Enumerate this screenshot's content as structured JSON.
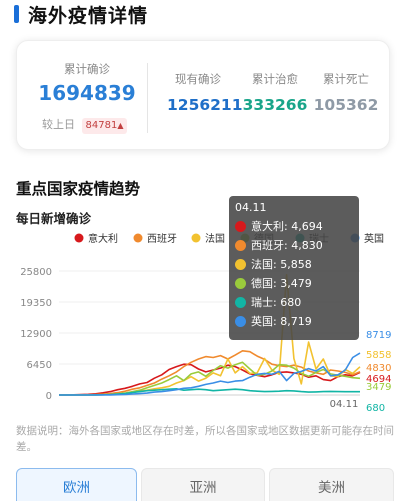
{
  "header": {
    "title": "海外疫情详情"
  },
  "summary": {
    "confirmed_label": "累计确诊",
    "confirmed_value": "1694839",
    "compare_label": "较上日",
    "compare_value": "84781",
    "compare_arrow": "▲",
    "stats": [
      {
        "label": "现有确诊",
        "value": "1256211",
        "color": "#1f6fc8"
      },
      {
        "label": "累计治愈",
        "value": "333266",
        "color": "#19a58a"
      },
      {
        "label": "累计死亡",
        "value": "105362",
        "color": "#8f9aa6"
      }
    ]
  },
  "trend": {
    "section_title": "重点国家疫情趋势",
    "chart_title": "每日新增确诊"
  },
  "chart_data": {
    "type": "line",
    "y_ticks": [
      "25800",
      "19350",
      "12900",
      "6450",
      "0"
    ],
    "ylim": [
      0,
      25800
    ],
    "x_label_visible": "04.11",
    "series": [
      {
        "name": "意大利",
        "color": "#d7191c",
        "end_value": 4694,
        "values": [
          10,
          20,
          40,
          90,
          150,
          260,
          460,
          700,
          1100,
          1400,
          1800,
          2300,
          2600,
          3500,
          4200,
          5300,
          5900,
          6400,
          6300,
          5400,
          4800,
          5200,
          5600,
          6200,
          5900,
          5200,
          4400,
          4100,
          3800,
          4200,
          4700,
          4800,
          4600,
          4300,
          3700,
          4000,
          3200,
          3000,
          3800,
          4200,
          4000,
          4694
        ]
      },
      {
        "name": "西班牙",
        "color": "#f08a2e",
        "end_value": 4830,
        "values": [
          0,
          5,
          10,
          20,
          40,
          80,
          160,
          300,
          500,
          800,
          1200,
          1500,
          2000,
          2500,
          3300,
          4000,
          4800,
          5900,
          6800,
          7500,
          8000,
          7800,
          8200,
          7500,
          8300,
          9200,
          9000,
          8100,
          7400,
          6400,
          6100,
          5900,
          6200,
          5800,
          5000,
          4600,
          4300,
          5200,
          5000,
          4700,
          4200,
          4830
        ]
      },
      {
        "name": "法国",
        "color": "#f2c230",
        "end_value": 5858,
        "values": [
          0,
          0,
          5,
          10,
          20,
          40,
          60,
          100,
          200,
          300,
          600,
          800,
          1000,
          1300,
          1500,
          1800,
          2500,
          3000,
          3800,
          2900,
          3500,
          4600,
          4000,
          7500,
          4600,
          5900,
          4500,
          4600,
          7600,
          5200,
          4300,
          25000,
          7600,
          2300,
          11000,
          5400,
          7500,
          4000,
          3800,
          5300,
          4500,
          5858
        ]
      },
      {
        "name": "德国",
        "color": "#9acb3c",
        "end_value": 3479,
        "values": [
          0,
          0,
          0,
          5,
          10,
          20,
          60,
          120,
          250,
          400,
          700,
          1000,
          1500,
          2000,
          2500,
          3200,
          4000,
          3000,
          4400,
          4800,
          3900,
          5100,
          6100,
          5600,
          6300,
          6800,
          5400,
          4100,
          4300,
          5000,
          6300,
          6200,
          5600,
          4500,
          3900,
          4700,
          5300,
          4400,
          4100,
          3900,
          3600,
          3479
        ]
      },
      {
        "name": "瑞士",
        "color": "#12b5a5",
        "end_value": 680,
        "values": [
          0,
          0,
          0,
          5,
          10,
          20,
          50,
          100,
          200,
          300,
          500,
          700,
          900,
          1000,
          1100,
          1200,
          1300,
          1000,
          1100,
          1200,
          1100,
          900,
          1000,
          1100,
          1200,
          1100,
          900,
          800,
          700,
          750,
          800,
          900,
          850,
          700,
          600,
          650,
          700,
          750,
          700,
          690,
          680,
          680
        ]
      },
      {
        "name": "英国",
        "color": "#3a8ee6",
        "end_value": 8719,
        "values": [
          0,
          0,
          0,
          0,
          5,
          10,
          20,
          30,
          60,
          100,
          200,
          300,
          400,
          600,
          700,
          900,
          1100,
          1400,
          1500,
          1800,
          2200,
          2500,
          2900,
          2600,
          2900,
          3000,
          3700,
          4300,
          4500,
          4300,
          4900,
          3000,
          4500,
          4900,
          5500,
          5000,
          5900,
          4000,
          4200,
          5200,
          7800,
          8719
        ]
      }
    ],
    "tooltip": {
      "date": "04.11",
      "rows": [
        {
          "label": "意大利: 4,694",
          "color": "#d7191c"
        },
        {
          "label": "西班牙: 4,830",
          "color": "#f08a2e"
        },
        {
          "label": "法国: 5,858",
          "color": "#f2c230"
        },
        {
          "label": "德国: 3,479",
          "color": "#9acb3c"
        },
        {
          "label": "瑞士: 680",
          "color": "#12b5a5"
        },
        {
          "label": "英国: 8,719",
          "color": "#3a8ee6"
        }
      ]
    }
  },
  "note": "数据说明：海外各国家或地区存在时差，所以各国家或地区数据更新可能存在时间差。",
  "tabs": [
    {
      "label": "欧洲",
      "active": true
    },
    {
      "label": "亚洲",
      "active": false
    },
    {
      "label": "美洲",
      "active": false
    }
  ]
}
